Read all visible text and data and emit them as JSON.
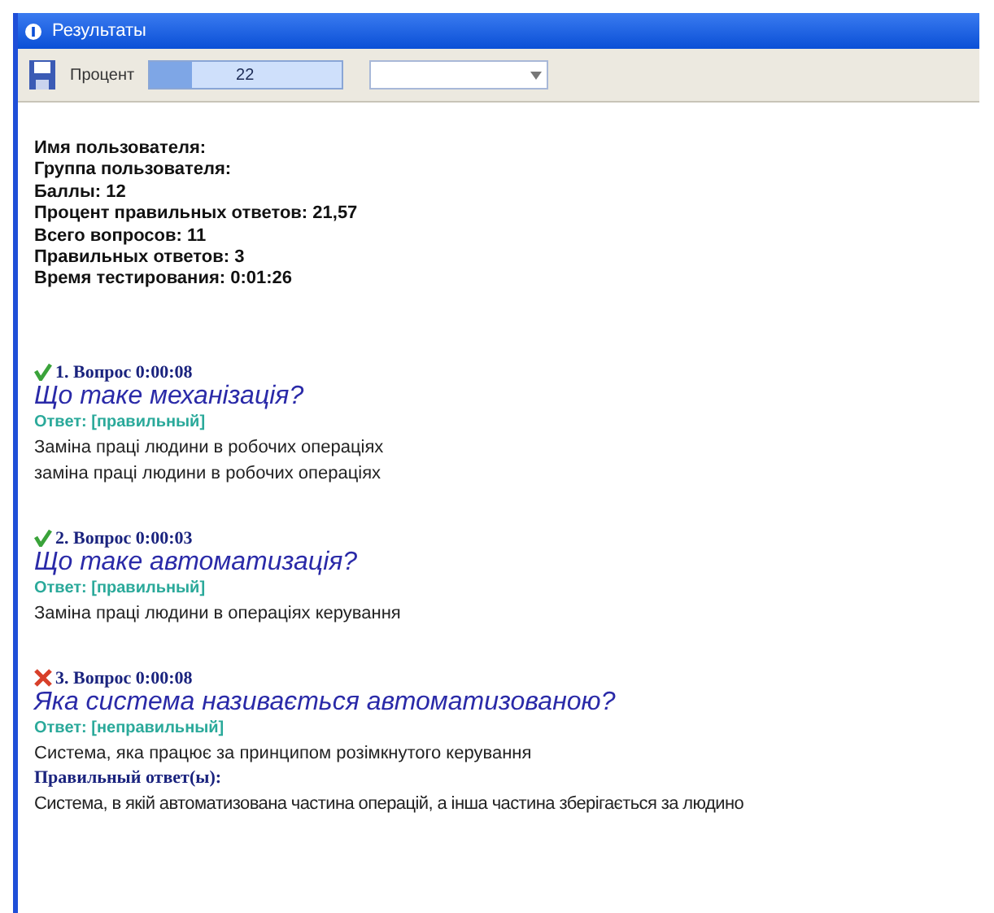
{
  "window": {
    "title": "Результаты"
  },
  "toolbar": {
    "percent_label": "Процент",
    "percent_value": "22",
    "level": 0.22
  },
  "summary": [
    {
      "label": "Имя пользователя:"
    },
    {
      "label": "Группа пользователя:"
    },
    {
      "label": "Баллы:",
      "value": "12"
    },
    {
      "label": "Процент правильных ответов:",
      "value": "21,57"
    },
    {
      "label": "Всего вопросов:",
      "value": "11"
    },
    {
      "label": "Правильных ответов:",
      "value": "3"
    },
    {
      "label": "Время тестирования:",
      "value": "0:01:26"
    }
  ],
  "questions": [
    {
      "correct": true,
      "header": "1. Вопрос 0:00:08",
      "question": "Що таке механізація?",
      "answer_label": "Ответ:",
      "answer_status": "[правильный]",
      "answers": [
        "Заміна праці людини в робочих операціях",
        "заміна праці людини в робочих операціях"
      ]
    },
    {
      "correct": true,
      "header": "2. Вопрос 0:00:03",
      "question": "Що таке автоматизація?",
      "answer_label": "Ответ:",
      "answer_status": "[правильный]",
      "answers": [
        "Заміна праці людини в операціях керування"
      ]
    },
    {
      "correct": false,
      "header": "3. Вопрос 0:00:08",
      "question": "Яка система називається автоматизованою?",
      "answer_label": "Ответ:",
      "answer_status": "[неправильный]",
      "answers": [
        "Система, яка працює за принципом розімкнутого керування"
      ],
      "correct_label": "Правильный ответ(ы):",
      "correct_answers": [
        "Система, в якій автоматизована частина операцій, а інша частина зберігається за людино"
      ]
    }
  ]
}
